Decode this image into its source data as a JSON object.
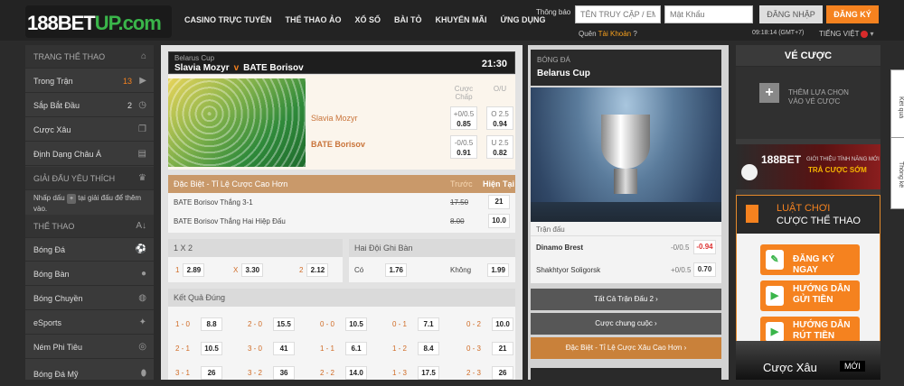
{
  "header": {
    "logo": {
      "p1": "188",
      "p2": "BET",
      "p3": "UP",
      "p4": ".com"
    },
    "nav": [
      "CASINO TRỰC TUYẾN",
      "THỂ THAO ẢO",
      "XỔ SỐ",
      "BÀI TỎ",
      "KHUYẾN MÃI",
      "ỨNG DỤNG"
    ],
    "notice_label": "Thông báo",
    "username_placeholder": "TÊN TRUY CẬP / EM",
    "password_placeholder": "Mật Khẩu",
    "login_button": "ĐĂNG NHẬP",
    "register_button": "ĐĂNG KÝ",
    "forgot_prefix": "Quên",
    "forgot_link": "Tài Khoản",
    "forgot_suffix": "?",
    "clock": "09:18:14 (GMT+7)",
    "language": "TIẾNG VIỆT",
    "language_caret": "▾"
  },
  "sidebar": {
    "home": "TRANG THỂ THAO",
    "live": "Trong Trận",
    "live_count": "13",
    "upcoming": "Sắp Bắt Đầu",
    "upcoming_count": "2",
    "parlay": "Cược Xâu",
    "asian": "Định Dạng Châu Á",
    "fav_head": "GIẢI ĐẤU YÊU THÍCH",
    "fav_text1": "Nhấp dấu",
    "fav_pill": "+",
    "fav_text2": "tại giải đấu để thêm vào.",
    "sports_head": "THỂ THAO",
    "sports": [
      "Bóng Đá",
      "Bóng Bàn",
      "Bóng Chuyền",
      "eSports",
      "Ném Phi Tiêu",
      "Bóng Đá Mỹ"
    ]
  },
  "match": {
    "league": "Belarus Cup",
    "home": "Slavia Mozyr",
    "vs": "v",
    "away": "BATE Borisov",
    "time": "21:30",
    "col_handicap": "Cược Chấp",
    "col_ou": "O/U",
    "h1_top": "+0/0.5",
    "h1_val": "0.85",
    "h2_top": "-0/0.5",
    "h2_val": "0.91",
    "o_top": "O 2.5",
    "o_val": "0.94",
    "u_top": "U 2.5",
    "u_val": "0.82"
  },
  "special": {
    "title": "Đặc Biệt - Tỉ Lệ Cược Cao Hơn",
    "col_before": "Trước",
    "col_now": "Hiện Tại",
    "rows": [
      {
        "label": "BATE Borisov Thắng 3-1",
        "old": "17.50",
        "new": "21"
      },
      {
        "label": "BATE Borisov Thắng Hai Hiệp Đấu",
        "old": "8.00",
        "new": "10.0"
      }
    ]
  },
  "x12": {
    "title": "1 X 2",
    "k1": "1",
    "v1": "2.89",
    "kx": "X",
    "vx": "3.30",
    "k2": "2",
    "v2": "2.12"
  },
  "btts": {
    "title": "Hai Đội Ghi Bàn",
    "yes": "Có",
    "yes_val": "1.76",
    "no": "Không",
    "no_val": "1.99"
  },
  "correct_score": {
    "title": "Kết Quả Đúng",
    "rows": [
      [
        [
          "1 - 0",
          "8.8"
        ],
        [
          "2 - 0",
          "15.5"
        ],
        [
          "0 - 0",
          "10.5"
        ],
        [
          "0 - 1",
          "7.1"
        ],
        [
          "0 - 2",
          "10.0"
        ]
      ],
      [
        [
          "2 - 1",
          "10.5"
        ],
        [
          "3 - 0",
          "41"
        ],
        [
          "1 - 1",
          "6.1"
        ],
        [
          "1 - 2",
          "8.4"
        ],
        [
          "0 - 3",
          "21"
        ]
      ],
      [
        [
          "3 - 1",
          "26"
        ],
        [
          "3 - 2",
          "36"
        ],
        [
          "2 - 2",
          "14.0"
        ],
        [
          "1 - 3",
          "17.5"
        ],
        [
          "2 - 3",
          "26"
        ]
      ]
    ]
  },
  "center": {
    "sport": "BÓNG ĐÁ",
    "league": "Belarus Cup",
    "panel_head": "Trận đấu",
    "matches": [
      {
        "name": "Dinamo Brest",
        "hcp": "-0/0.5",
        "odd": "-0.94",
        "odd_color": "#d33"
      },
      {
        "name": "Shakhtyor Soligorsk",
        "hcp": "+0/0.5",
        "odd": "0.70",
        "odd_color": "#222"
      }
    ],
    "btn_all": "Tất Cả Trận Đấu 2 ›",
    "btn_combo": "Cược chung cuộc ›",
    "btn_special": "Đặc Biệt - Tỉ Lệ Cược Xâu Cao Hơn ›"
  },
  "right": {
    "title": "VÉ CƯỢC",
    "add_text1": "THÊM LỰA CHỌN",
    "add_text2": "VÀO VÉ CƯỢC",
    "promo_brand": "188BET",
    "promo_sub": "GIỚI THIỆU TÍNH NĂNG MỚI",
    "promo_main": "TRẢ CƯỢC SỚM",
    "rules1": "LUẬT CHƠI",
    "rules2": "CƯỢC THỂ THAO",
    "btn1": "ĐĂNG KÝ NGAY",
    "btn2a": "HƯỚNG DẪN",
    "btn2b": "GỬI TIỀN",
    "btn3a": "HƯỚNG DẪN",
    "btn3b": "RÚT TIỀN",
    "parlay": "Cược Xâu",
    "new_badge": "MỚI"
  },
  "tabs": {
    "t1": "Kết quả",
    "t2": "Thống kê"
  }
}
